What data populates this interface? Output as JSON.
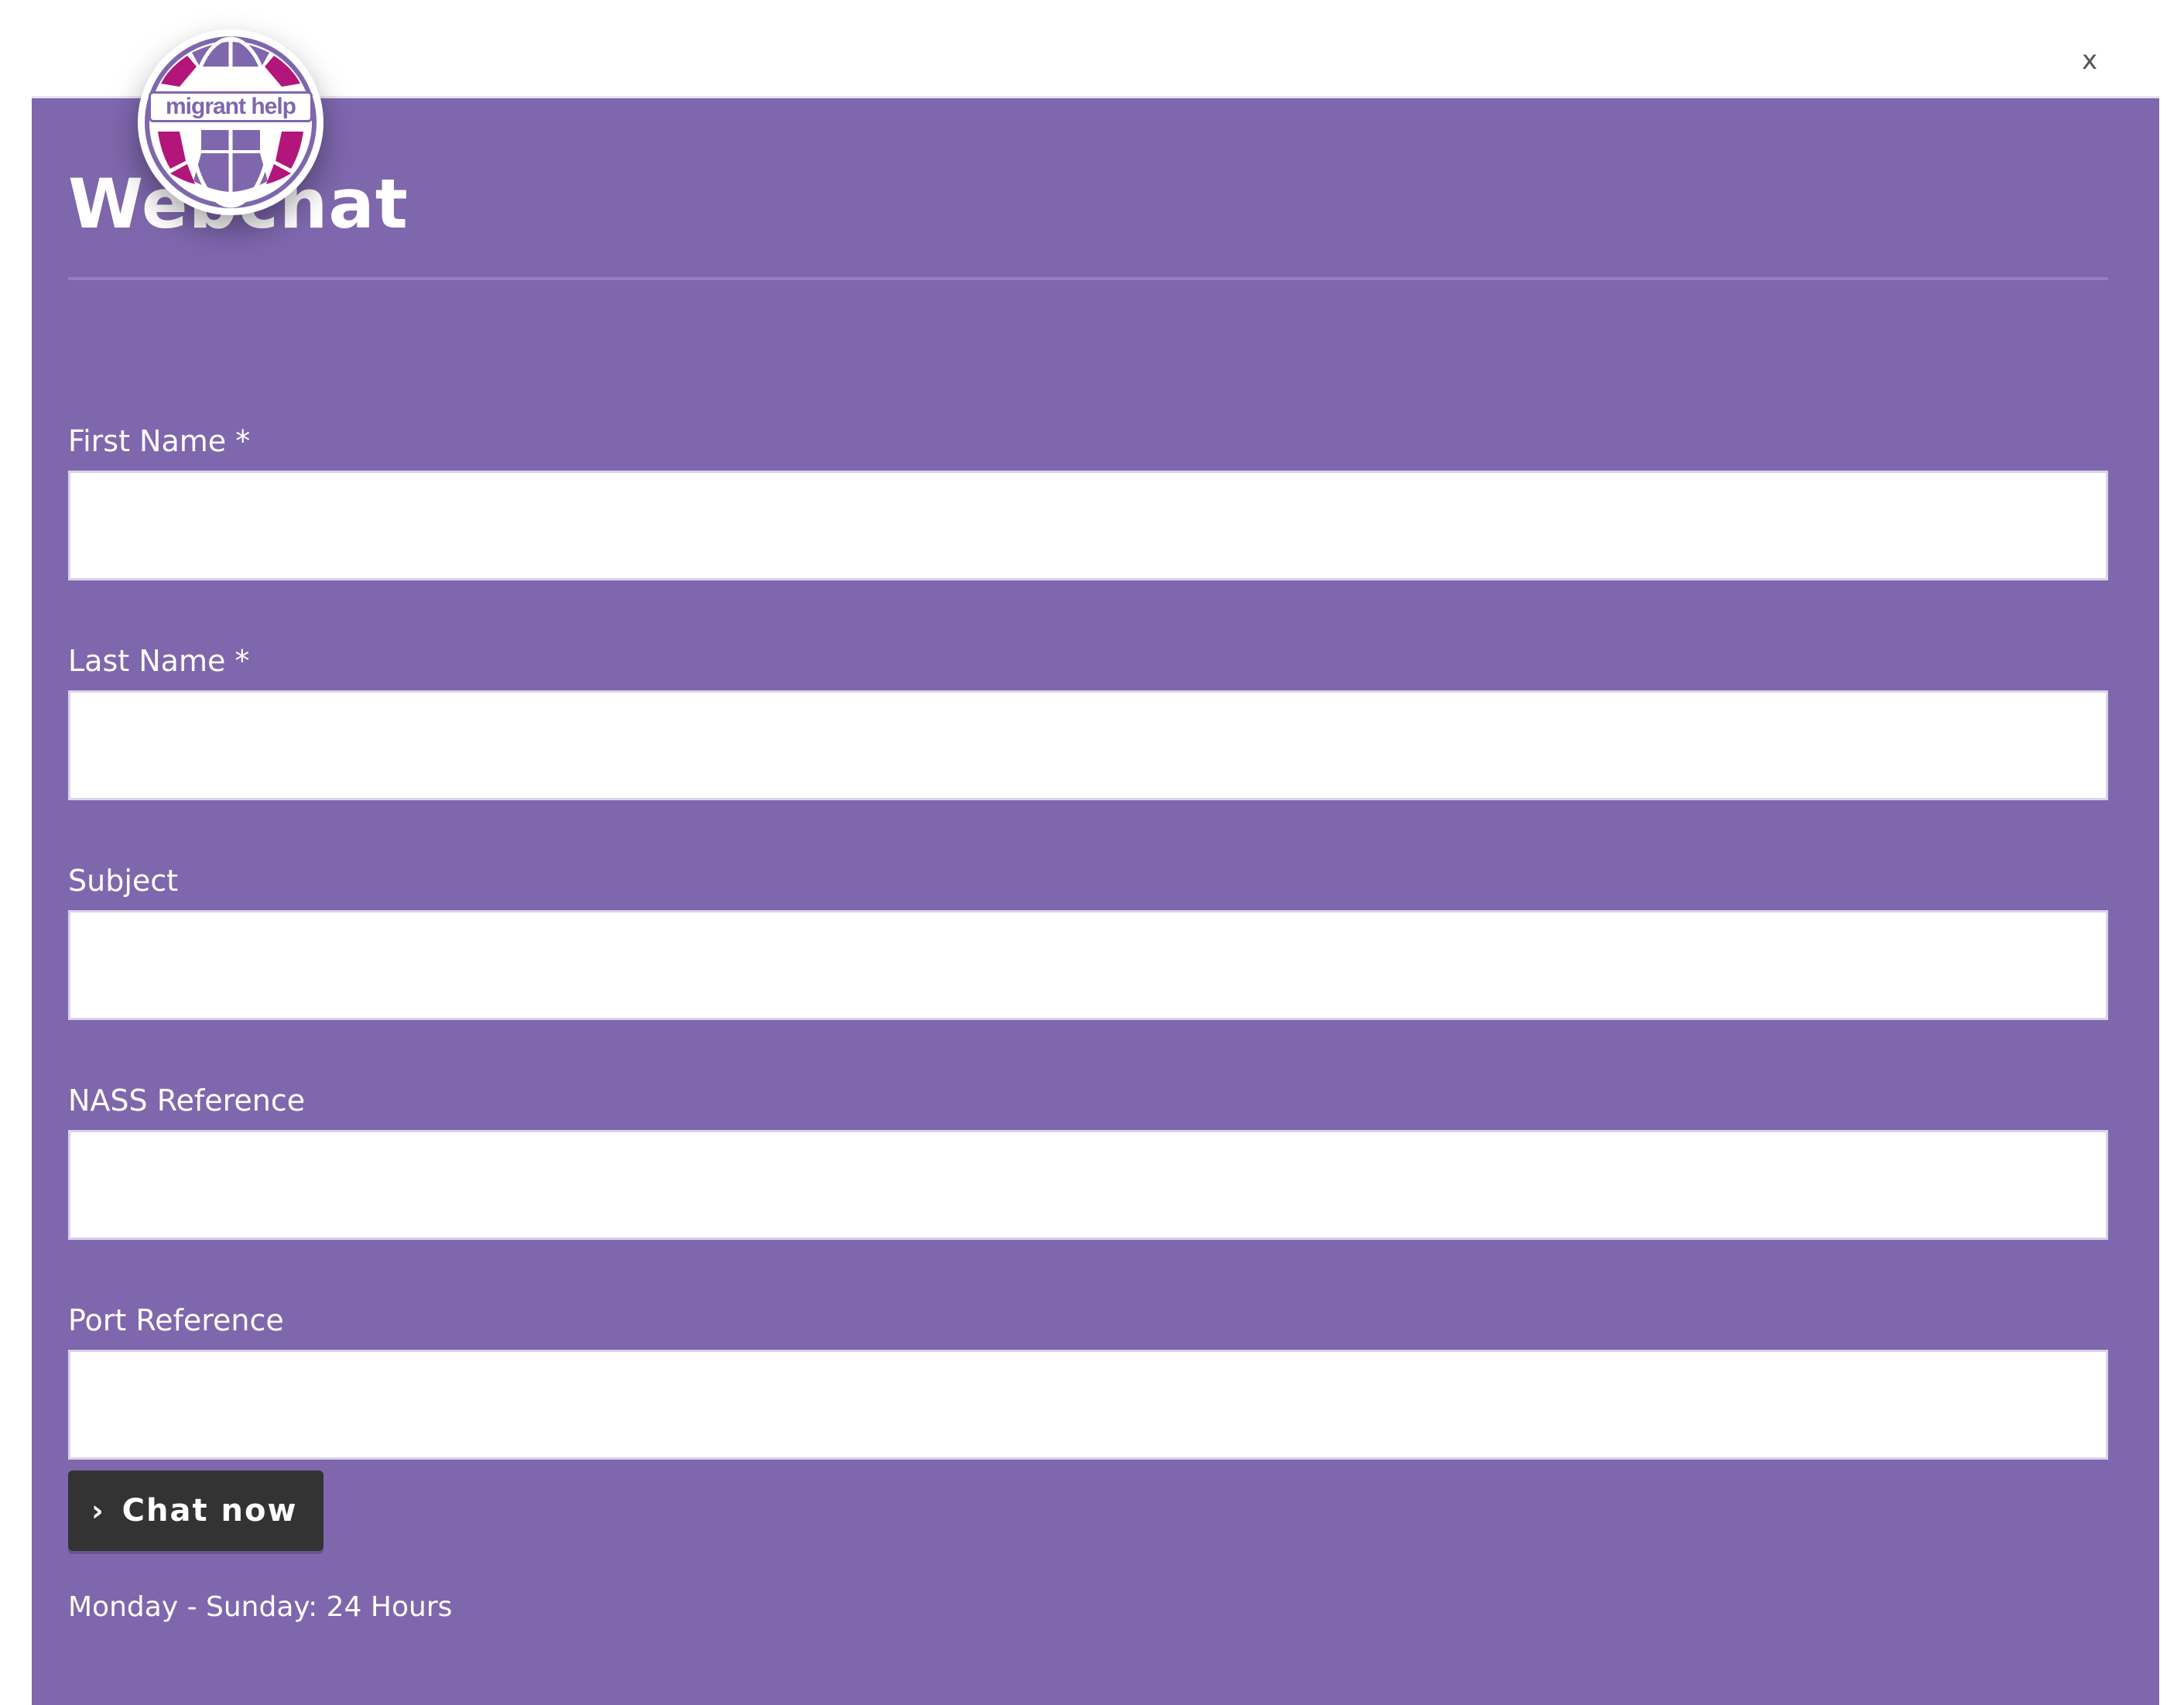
{
  "header": {
    "close_label": "x",
    "logo_text": "migrant help"
  },
  "panel": {
    "title": "Webchat"
  },
  "form": {
    "fields": [
      {
        "label": "First Name *",
        "value": "",
        "placeholder": ""
      },
      {
        "label": "Last Name *",
        "value": "",
        "placeholder": ""
      },
      {
        "label": "Subject",
        "value": "",
        "placeholder": ""
      },
      {
        "label": "NASS Reference",
        "value": "",
        "placeholder": ""
      },
      {
        "label": "Port Reference",
        "value": "",
        "placeholder": ""
      }
    ],
    "submit_label": "Chat now",
    "submit_chevron": "›"
  },
  "footer": {
    "hours_text": "Monday - Sunday: 24 Hours"
  },
  "colors": {
    "panel_bg": "#7e67ad",
    "accent_magenta": "#b3167a",
    "button_bg": "#333333"
  },
  "icons": {
    "close": "close-icon",
    "logo": "globe-logo",
    "chevron": "chevron-right-icon"
  }
}
